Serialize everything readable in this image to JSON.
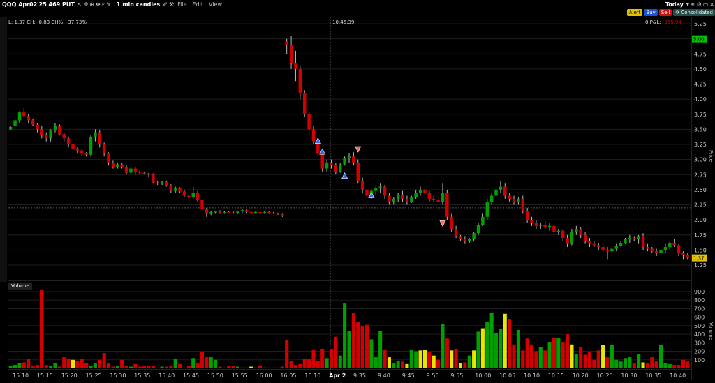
{
  "titlebar": {
    "instrument": "QQQ Apr02'25 469 PUT",
    "chart_type": "1 min candles",
    "menus": [
      "File",
      "Edit",
      "View"
    ],
    "range": "Today"
  },
  "order_buttons": {
    "alert": "Alert",
    "buy": "Buy",
    "sell": "Sell",
    "consolidated": "Consolidated"
  },
  "colors": {
    "up": "#00a000",
    "down": "#d40000",
    "neutral": "#e6e600",
    "grid": "#1e1e1e",
    "background": "#000000"
  },
  "info": {
    "line": "L: 1.37  CH: -0.83  CH%: -37.73%",
    "cursor_time": "10:45:39",
    "pnl_label": "0  P&L:",
    "pnl_value": "-955.94"
  },
  "volume_label": "Volume",
  "axes": {
    "price_label": "Price",
    "volume_label": "Volume",
    "current_price": "1.37",
    "price_marker": "5.00"
  },
  "chart_data": {
    "type": "candlestick",
    "price_axis": {
      "min": 1.25,
      "max": 5.25,
      "ticks": [
        "1.25",
        "1.50",
        "1.75",
        "2.00",
        "2.25",
        "2.50",
        "2.75",
        "3.00",
        "3.25",
        "3.50",
        "3.75",
        "4.00",
        "4.25",
        "4.50",
        "4.75",
        "5.00",
        "5.25"
      ]
    },
    "volume_axis": {
      "min": 0,
      "max": 900,
      "ticks": [
        "100",
        "200",
        "300",
        "400",
        "500",
        "600",
        "700",
        "800",
        "900"
      ]
    },
    "time_labels": [
      "15:10",
      "15:15",
      "15:20",
      "15:25",
      "15:30",
      "15:35",
      "15:40",
      "15:45",
      "15:50",
      "15:55",
      "16:00",
      "16:05",
      "16:10",
      "Apr 2",
      "9:35",
      "9:40",
      "9:45",
      "9:50",
      "9:55",
      "10:00",
      "10:05",
      "10:10",
      "10:15",
      "10:20",
      "10:25",
      "10:30",
      "10:35",
      "10:40"
    ],
    "candles": [
      [
        3.5,
        3.55,
        3.48,
        3.54,
        30
      ],
      [
        3.55,
        3.7,
        3.53,
        3.65,
        40
      ],
      [
        3.65,
        3.8,
        3.6,
        3.78,
        60
      ],
      [
        3.78,
        3.85,
        3.7,
        3.72,
        70
      ],
      [
        3.72,
        3.75,
        3.6,
        3.65,
        110
      ],
      [
        3.65,
        3.68,
        3.55,
        3.58,
        30
      ],
      [
        3.58,
        3.6,
        3.45,
        3.5,
        40
      ],
      [
        3.5,
        3.55,
        3.35,
        3.4,
        920
      ],
      [
        3.4,
        3.45,
        3.3,
        3.35,
        40
      ],
      [
        3.35,
        3.5,
        3.3,
        3.48,
        30
      ],
      [
        3.48,
        3.6,
        3.45,
        3.55,
        60
      ],
      [
        3.55,
        3.58,
        3.4,
        3.42,
        20
      ],
      [
        3.42,
        3.45,
        3.3,
        3.35,
        130
      ],
      [
        3.35,
        3.38,
        3.2,
        3.25,
        110
      ],
      [
        3.25,
        3.28,
        3.15,
        3.18,
        100
      ],
      [
        3.18,
        3.2,
        3.1,
        3.15,
        90
      ],
      [
        3.15,
        3.18,
        3.05,
        3.1,
        110
      ],
      [
        3.1,
        3.12,
        3.05,
        3.08,
        60
      ],
      [
        3.08,
        3.4,
        3.05,
        3.38,
        30
      ],
      [
        3.38,
        3.5,
        3.3,
        3.45,
        60
      ],
      [
        3.45,
        3.48,
        3.2,
        3.25,
        100
      ],
      [
        3.25,
        3.28,
        3.05,
        3.1,
        180
      ],
      [
        3.1,
        3.12,
        2.9,
        2.95,
        60
      ],
      [
        2.95,
        2.98,
        2.85,
        2.88,
        20
      ],
      [
        2.88,
        2.95,
        2.85,
        2.92,
        30
      ],
      [
        2.92,
        2.95,
        2.85,
        2.88,
        100
      ],
      [
        2.88,
        2.9,
        2.75,
        2.78,
        30
      ],
      [
        2.78,
        2.9,
        2.75,
        2.85,
        20
      ],
      [
        2.85,
        2.88,
        2.75,
        2.8,
        50
      ],
      [
        2.8,
        2.82,
        2.75,
        2.78,
        20
      ],
      [
        2.78,
        2.8,
        2.75,
        2.77,
        30
      ],
      [
        2.77,
        2.78,
        2.72,
        2.75,
        30
      ],
      [
        2.75,
        2.77,
        2.6,
        2.62,
        30
      ],
      [
        2.62,
        2.64,
        2.58,
        2.6,
        10
      ],
      [
        2.6,
        2.65,
        2.58,
        2.63,
        20
      ],
      [
        2.63,
        2.65,
        2.55,
        2.57,
        20
      ],
      [
        2.57,
        2.59,
        2.45,
        2.48,
        30
      ],
      [
        2.48,
        2.55,
        2.45,
        2.52,
        110
      ],
      [
        2.52,
        2.54,
        2.45,
        2.47,
        50
      ],
      [
        2.47,
        2.5,
        2.38,
        2.4,
        10
      ],
      [
        2.4,
        2.42,
        2.35,
        2.38,
        30
      ],
      [
        2.38,
        2.55,
        2.35,
        2.45,
        120
      ],
      [
        2.45,
        2.48,
        2.3,
        2.33,
        60
      ],
      [
        2.33,
        2.35,
        2.15,
        2.18,
        190
      ],
      [
        2.18,
        2.2,
        2.05,
        2.1,
        130
      ],
      [
        2.1,
        2.15,
        2.08,
        2.13,
        130
      ],
      [
        2.13,
        2.15,
        2.1,
        2.14,
        100
      ],
      [
        2.14,
        2.16,
        2.1,
        2.12,
        20
      ],
      [
        2.12,
        2.14,
        2.1,
        2.13,
        10
      ],
      [
        2.13,
        2.14,
        2.11,
        2.12,
        30
      ],
      [
        2.12,
        2.14,
        2.1,
        2.11,
        30
      ],
      [
        2.11,
        2.15,
        2.1,
        2.14,
        20
      ],
      [
        2.14,
        2.18,
        2.1,
        2.16,
        10
      ],
      [
        2.16,
        2.17,
        2.1,
        2.13,
        10
      ],
      [
        2.13,
        2.14,
        2.1,
        2.12,
        20
      ],
      [
        2.12,
        2.14,
        2.1,
        2.13,
        10
      ],
      [
        2.13,
        2.14,
        2.11,
        2.12,
        30
      ],
      [
        2.12,
        2.14,
        2.1,
        2.13,
        10
      ],
      [
        2.13,
        2.14,
        2.1,
        2.12,
        10
      ],
      [
        2.12,
        2.13,
        2.1,
        2.11,
        10
      ],
      [
        2.11,
        2.12,
        2.08,
        2.09,
        10
      ],
      [
        2.09,
        2.1,
        2.05,
        2.07,
        20
      ],
      [
        4.95,
        5.0,
        4.75,
        4.9,
        330
      ],
      [
        4.9,
        5.05,
        4.5,
        4.6,
        90
      ],
      [
        4.6,
        4.8,
        4.3,
        4.5,
        40
      ],
      [
        4.5,
        4.55,
        4.0,
        4.1,
        50
      ],
      [
        4.1,
        4.15,
        3.7,
        3.75,
        110
      ],
      [
        3.75,
        3.8,
        3.4,
        3.5,
        110
      ],
      [
        3.5,
        3.55,
        3.25,
        3.3,
        220
      ],
      [
        3.3,
        3.35,
        3.05,
        3.1,
        90
      ],
      [
        3.1,
        3.15,
        2.8,
        2.85,
        230
      ],
      [
        2.85,
        3.0,
        2.8,
        2.95,
        120
      ],
      [
        2.95,
        3.0,
        2.85,
        2.9,
        230
      ],
      [
        2.9,
        2.95,
        2.75,
        2.8,
        370
      ],
      [
        2.8,
        2.95,
        2.78,
        2.92,
        150
      ],
      [
        2.92,
        3.05,
        2.9,
        3.02,
        760
      ],
      [
        3.02,
        3.1,
        2.95,
        3.05,
        440
      ],
      [
        3.05,
        3.12,
        2.9,
        2.95,
        650
      ],
      [
        2.95,
        3.0,
        2.6,
        2.65,
        550
      ],
      [
        2.65,
        2.7,
        2.45,
        2.5,
        490
      ],
      [
        2.5,
        2.55,
        2.35,
        2.4,
        510
      ],
      [
        2.4,
        2.5,
        2.35,
        2.48,
        340
      ],
      [
        2.48,
        2.55,
        2.4,
        2.52,
        130
      ],
      [
        2.52,
        2.6,
        2.45,
        2.55,
        440
      ],
      [
        2.55,
        2.58,
        2.35,
        2.4,
        220
      ],
      [
        2.4,
        2.45,
        2.25,
        2.3,
        130
      ],
      [
        2.3,
        2.38,
        2.25,
        2.35,
        60
      ],
      [
        2.35,
        2.45,
        2.3,
        2.42,
        90
      ],
      [
        2.42,
        2.48,
        2.3,
        2.35,
        80
      ],
      [
        2.35,
        2.4,
        2.25,
        2.3,
        50
      ],
      [
        2.3,
        2.4,
        2.28,
        2.38,
        220
      ],
      [
        2.38,
        2.5,
        2.35,
        2.45,
        200
      ],
      [
        2.45,
        2.55,
        2.4,
        2.5,
        210
      ],
      [
        2.5,
        2.55,
        2.4,
        2.45,
        220
      ],
      [
        2.45,
        2.48,
        2.3,
        2.35,
        190
      ],
      [
        2.35,
        2.4,
        2.3,
        2.33,
        150
      ],
      [
        2.33,
        2.38,
        2.28,
        2.3,
        100
      ],
      [
        2.3,
        2.6,
        2.25,
        2.45,
        520
      ],
      [
        2.45,
        2.5,
        2.0,
        2.05,
        350
      ],
      [
        2.05,
        2.1,
        1.8,
        1.85,
        210
      ],
      [
        1.85,
        1.9,
        1.7,
        1.72,
        230
      ],
      [
        1.72,
        1.75,
        1.65,
        1.68,
        60
      ],
      [
        1.68,
        1.72,
        1.6,
        1.65,
        70
      ],
      [
        1.65,
        1.7,
        1.62,
        1.68,
        150
      ],
      [
        1.68,
        1.8,
        1.65,
        1.78,
        210
      ],
      [
        1.78,
        1.95,
        1.75,
        1.92,
        430
      ],
      [
        1.92,
        2.1,
        1.9,
        2.05,
        470
      ],
      [
        2.05,
        2.35,
        2.0,
        2.3,
        540
      ],
      [
        2.3,
        2.45,
        2.25,
        2.4,
        650
      ],
      [
        2.4,
        2.55,
        2.35,
        2.5,
        410
      ],
      [
        2.5,
        2.65,
        2.45,
        2.55,
        460
      ],
      [
        2.55,
        2.6,
        2.35,
        2.4,
        640
      ],
      [
        2.4,
        2.45,
        2.3,
        2.35,
        580
      ],
      [
        2.35,
        2.4,
        2.25,
        2.3,
        280
      ],
      [
        2.3,
        2.38,
        2.25,
        2.35,
        450
      ],
      [
        2.35,
        2.4,
        2.1,
        2.15,
        210
      ],
      [
        2.15,
        2.2,
        1.95,
        2.0,
        350
      ],
      [
        2.0,
        2.05,
        1.9,
        1.95,
        280
      ],
      [
        1.95,
        2.0,
        1.85,
        1.9,
        200
      ],
      [
        1.9,
        1.95,
        1.85,
        1.92,
        250
      ],
      [
        1.92,
        1.98,
        1.85,
        1.88,
        210
      ],
      [
        1.88,
        1.95,
        1.82,
        1.9,
        310
      ],
      [
        1.9,
        1.92,
        1.75,
        1.8,
        360
      ],
      [
        1.8,
        1.85,
        1.75,
        1.82,
        360
      ],
      [
        1.82,
        1.85,
        1.65,
        1.7,
        310
      ],
      [
        1.7,
        1.75,
        1.55,
        1.6,
        400
      ],
      [
        1.6,
        1.85,
        1.58,
        1.8,
        280
      ],
      [
        1.8,
        1.9,
        1.75,
        1.85,
        170
      ],
      [
        1.85,
        1.88,
        1.7,
        1.75,
        250
      ],
      [
        1.75,
        1.8,
        1.6,
        1.65,
        160
      ],
      [
        1.65,
        1.7,
        1.55,
        1.6,
        190
      ],
      [
        1.6,
        1.65,
        1.55,
        1.58,
        100
      ],
      [
        1.58,
        1.62,
        1.5,
        1.55,
        210
      ],
      [
        1.55,
        1.6,
        1.45,
        1.5,
        270
      ],
      [
        1.5,
        1.55,
        1.35,
        1.48,
        130
      ],
      [
        1.48,
        1.55,
        1.45,
        1.52,
        270
      ],
      [
        1.52,
        1.6,
        1.48,
        1.57,
        100
      ],
      [
        1.57,
        1.65,
        1.55,
        1.62,
        80
      ],
      [
        1.62,
        1.7,
        1.6,
        1.68,
        120
      ],
      [
        1.68,
        1.75,
        1.62,
        1.7,
        130
      ],
      [
        1.7,
        1.72,
        1.65,
        1.68,
        60
      ],
      [
        1.68,
        1.75,
        1.6,
        1.72,
        170
      ],
      [
        1.72,
        1.78,
        1.5,
        1.55,
        70
      ],
      [
        1.55,
        1.6,
        1.48,
        1.52,
        60
      ],
      [
        1.52,
        1.55,
        1.45,
        1.48,
        130
      ],
      [
        1.48,
        1.52,
        1.4,
        1.45,
        80
      ],
      [
        1.45,
        1.55,
        1.42,
        1.5,
        270
      ],
      [
        1.5,
        1.6,
        1.45,
        1.55,
        60
      ],
      [
        1.55,
        1.65,
        1.5,
        1.62,
        50
      ],
      [
        1.62,
        1.68,
        1.55,
        1.58,
        40
      ],
      [
        1.58,
        1.6,
        1.4,
        1.45,
        40
      ],
      [
        1.45,
        1.48,
        1.35,
        1.42,
        100
      ],
      [
        1.42,
        1.45,
        1.35,
        1.37,
        80
      ]
    ],
    "neutral_bars": [
      14,
      54,
      85,
      89,
      92,
      93,
      95,
      99,
      101,
      104,
      106,
      111,
      126,
      133,
      142
    ],
    "markers": [
      {
        "type": "buy",
        "index": 69,
        "price": 3.3
      },
      {
        "type": "buy",
        "index": 70,
        "price": 3.12
      },
      {
        "type": "buy",
        "index": 75,
        "price": 2.72
      },
      {
        "type": "sell",
        "index": 78,
        "price": 3.18
      },
      {
        "type": "buy",
        "index": 81,
        "price": 2.4
      },
      {
        "type": "sell",
        "index": 97,
        "price": 1.95
      }
    ]
  }
}
